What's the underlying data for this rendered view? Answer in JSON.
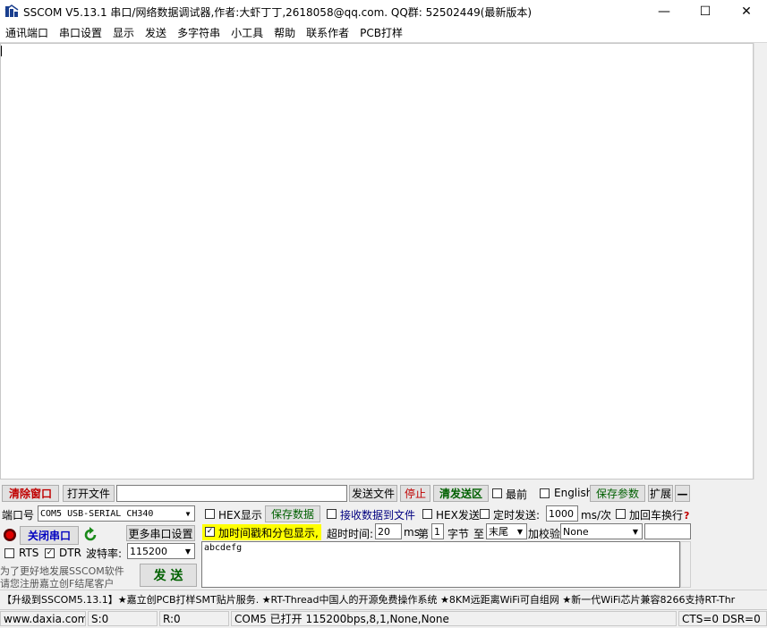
{
  "window": {
    "title": "SSCOM V5.13.1 串口/网络数据调试器,作者:大虾丁丁,2618058@qq.com. QQ群: 52502449(最新版本)",
    "minimize": "—",
    "maximize": "☐",
    "close": "✕"
  },
  "menu": [
    "通讯端口",
    "串口设置",
    "显示",
    "发送",
    "多字符串",
    "小工具",
    "帮助",
    "联系作者",
    "PCB打样"
  ],
  "toolbar": {
    "clear_window": "清除窗口",
    "open_file": "打开文件",
    "file_path": "",
    "send_file": "发送文件",
    "stop": "停止",
    "clear_send": "清发送区",
    "topmost_label": "最前",
    "english_label": "English",
    "save_params": "保存参数",
    "expand": "扩展",
    "collapse": "—"
  },
  "port": {
    "label": "端口号",
    "value": "COM5 USB-SERIAL CH340",
    "more_settings": "更多串口设置",
    "close_port": "关闭串口",
    "rts_label": "RTS",
    "dtr_label": "DTR",
    "baud_label": "波特率:",
    "baud_value": "115200"
  },
  "options": {
    "hex_display": "HEX显示",
    "save_data": "保存数据",
    "recv_to_file": "接收数据到文件",
    "hex_send": "HEX发送",
    "timed_send": "定时发送:",
    "interval_value": "1000",
    "interval_unit": "ms/次",
    "add_crlf": "加回车换行",
    "timestamp": "加时间戳和分包显示,",
    "timeout_label": "超时时间:",
    "timeout_value": "20",
    "timeout_unit": "ms",
    "nth_label": "第",
    "nth_value": "1",
    "byte_label": "字节",
    "to_label": "至",
    "end_value": "末尾",
    "checksum_label": "加校验",
    "checksum_value": "None"
  },
  "send": {
    "text": "abcdefg",
    "send_button": "发 送"
  },
  "promo": {
    "line1": "为了更好地发展SSCOM软件",
    "line2": "请您注册嘉立创F结尾客户"
  },
  "ticker": "【升级到SSCOM5.13.1】★嘉立创PCB打样SMT贴片服务. ★RT-Thread中国人的开源免费操作系统 ★8KM远距离WiFi可自组网 ★新一代WiFi芯片兼容8266支持RT-Thr",
  "status": {
    "site": "www.daxia.com",
    "sent": "S:0",
    "received": "R:0",
    "port_status": "COM5 已打开  115200bps,8,1,None,None",
    "signals": "CTS=0 DSR=0"
  },
  "colors": {
    "clear_window": "#c00000",
    "stop": "#c00000",
    "clear_send": "#006000",
    "save": "#006000",
    "highlight": "#ffff00",
    "close_port": "#0000c0",
    "recv_link": "#000080"
  }
}
